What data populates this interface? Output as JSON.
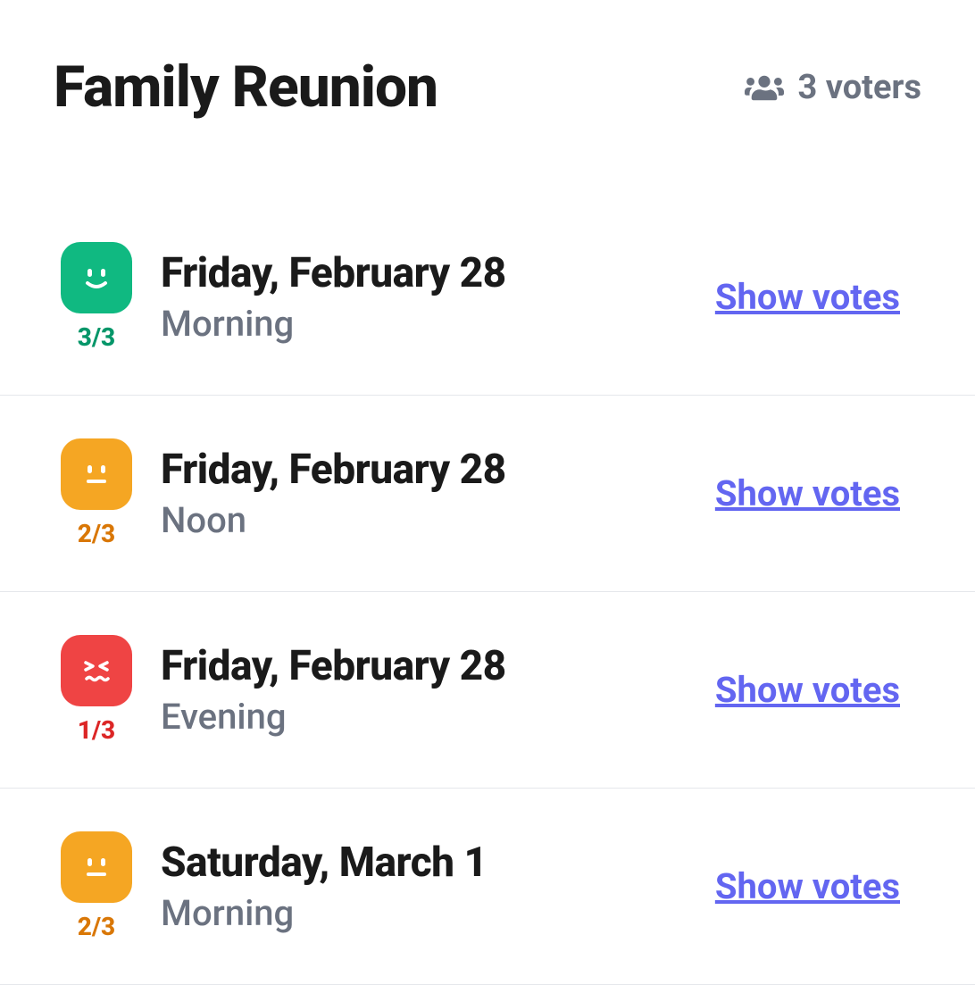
{
  "header": {
    "title": "Family Reunion",
    "voters_label": "3 voters"
  },
  "show_votes_label": "Show votes",
  "slots": [
    {
      "date": "Friday, February 28",
      "time": "Morning",
      "ratio": "3/3",
      "mood": "happy"
    },
    {
      "date": "Friday, February 28",
      "time": "Noon",
      "ratio": "2/3",
      "mood": "neutral"
    },
    {
      "date": "Friday, February 28",
      "time": "Evening",
      "ratio": "1/3",
      "mood": "sad"
    },
    {
      "date": "Saturday, March 1",
      "time": "Morning",
      "ratio": "2/3",
      "mood": "neutral"
    }
  ]
}
